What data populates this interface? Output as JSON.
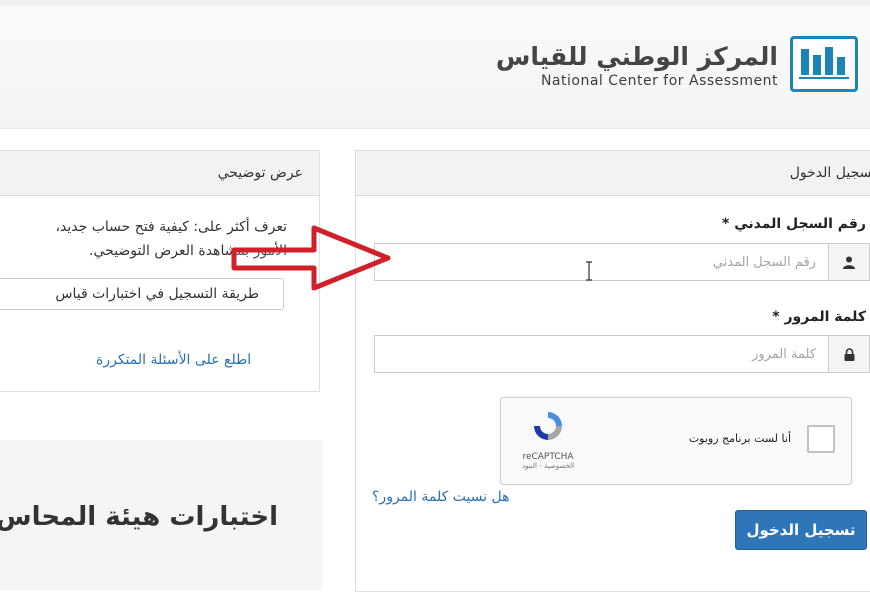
{
  "brand": {
    "name_ar": "المركز الوطني للقياس",
    "name_en": "National Center for Assessment",
    "logo_mark_ar": "قياس"
  },
  "login": {
    "heading": "تسجيل الدخول",
    "civil_id": {
      "label": "رقم السجل المدني *",
      "placeholder": "رقم السجل المدني",
      "icon": "user-icon"
    },
    "password": {
      "label": "كلمة المرور *",
      "placeholder": "كلمة المرور",
      "icon": "lock-icon"
    },
    "captcha": {
      "label": "أنا لست برنامج روبوت",
      "brand": "reCAPTCHA",
      "links": "الخصوصية - البنود"
    },
    "forgot_password": "هل نسيت كلمة المرور؟",
    "submit": "تسجيل الدخول"
  },
  "demo": {
    "heading": "عرض توضيحي",
    "text_line1": "تعرف أكثر على: كيفية فتح حساب جديد،",
    "text_line2": "الأمور بمشاهدة العرض التوضيحي.",
    "button": "طريقة التسجيل في اختبارات قياس",
    "faq_link": "اطلع على الأسئلة المتكررة"
  },
  "promo": {
    "title": "اختبارات هيئة المحاس"
  },
  "colors": {
    "primary": "#2e76b8",
    "link": "#2a6fb0",
    "logo": "#1c84b8",
    "arrow": "#d0202a"
  }
}
